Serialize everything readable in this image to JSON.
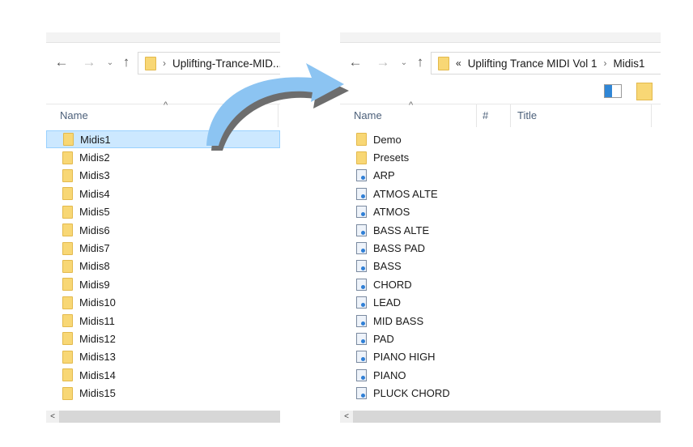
{
  "left": {
    "path": [
      "Uplifting-Trance-MID..."
    ],
    "columns": {
      "name": "Name"
    },
    "items": [
      "Midis1",
      "Midis2",
      "Midis3",
      "Midis4",
      "Midis5",
      "Midis6",
      "Midis7",
      "Midis8",
      "Midis9",
      "Midis10",
      "Midis11",
      "Midis12",
      "Midis13",
      "Midis14",
      "Midis15"
    ],
    "selected": "Midis1"
  },
  "right": {
    "path_overflow": "«",
    "path": [
      "Uplifting Trance MIDI Vol 1",
      "Midis1"
    ],
    "columns": {
      "name": "Name",
      "number": "#",
      "title": "Title"
    },
    "folders": [
      "Demo",
      "Presets"
    ],
    "files": [
      "ARP",
      "ATMOS ALTE",
      "ATMOS",
      "BASS ALTE",
      "BASS PAD",
      "BASS",
      "CHORD",
      "LEAD",
      "MID BASS",
      "PAD",
      "PIANO HIGH",
      "PIANO",
      "PLUCK CHORD"
    ]
  },
  "icons": {
    "back": "←",
    "forward": "→",
    "recent": "⌄",
    "up": "↑",
    "scroll_left": "<",
    "sort": "^",
    "arrow": "curved-arrow-right"
  },
  "colors": {
    "selection": "#cce8ff",
    "folder": "#f8d775",
    "arrow": "#8cc4f2"
  }
}
